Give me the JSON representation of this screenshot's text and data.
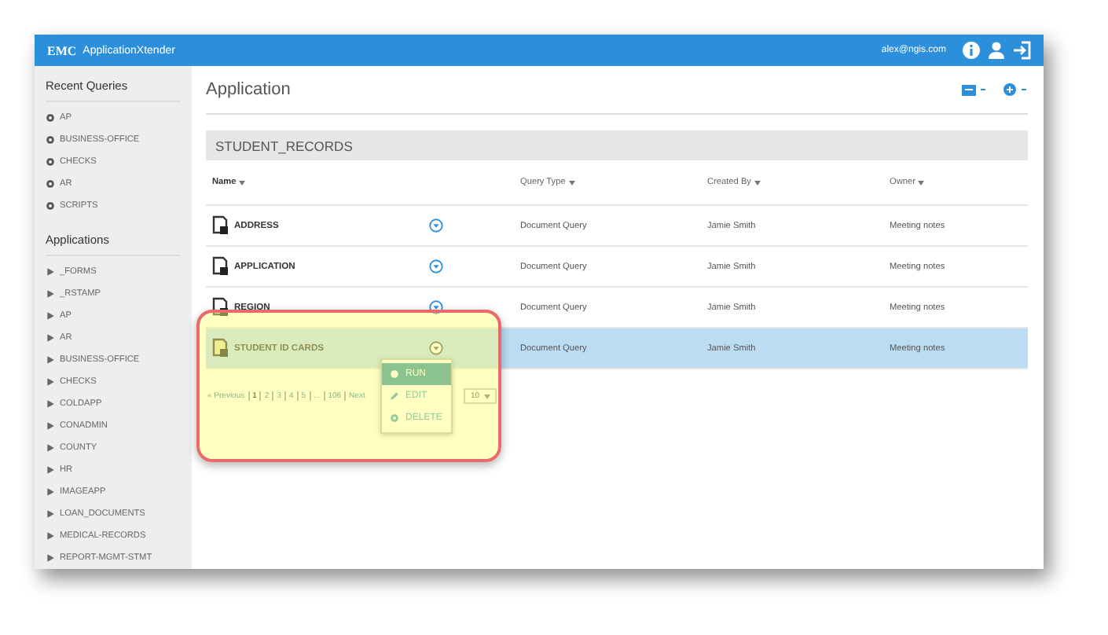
{
  "window": {
    "brand": "EMC",
    "product": "ApplicationXtender",
    "user": "alex@ngis.com"
  },
  "sidebar": {
    "sections": [
      {
        "title": "Recent Queries",
        "kind": "recent",
        "items": [
          "AP",
          "BUSINESS-OFFICE",
          "CHECKS",
          "AR",
          "SCRIPTS"
        ]
      },
      {
        "title": "Applications",
        "kind": "apps",
        "items": [
          "_FORMS",
          "_RSTAMP",
          "AP",
          "AR",
          "BUSINESS-OFFICE",
          "CHECKS",
          "COLDAPP",
          "CONADMIN",
          "COUNTY",
          "HR",
          "IMAGEAPP",
          "LOAN_DOCUMENTS",
          "MEDICAL-RECORDS",
          "REPORT-MGMT-STMT"
        ]
      }
    ]
  },
  "page": {
    "title": "Application"
  },
  "table": {
    "title": "STUDENT_RECORDS",
    "columns": [
      "Name",
      "Query Type",
      "Created By",
      "Owner"
    ],
    "rows": [
      {
        "name": "ADDRESS",
        "query_type": "Document Query",
        "created_by": "Jamie Smith",
        "owner": "Meeting notes",
        "selected": false
      },
      {
        "name": "APPLICATION",
        "query_type": "Document Query",
        "created_by": "Jamie Smith",
        "owner": "Meeting notes",
        "selected": false
      },
      {
        "name": "REGION",
        "query_type": "Document Query",
        "created_by": "Jamie Smith",
        "owner": "Meeting notes",
        "selected": false
      },
      {
        "name": "STUDENT ID CARDS",
        "query_type": "Document Query",
        "created_by": "Jamie Smith",
        "owner": "Meeting notes",
        "selected": true
      }
    ]
  },
  "pagination": {
    "previous": "« Previous",
    "pages": [
      {
        "label": "1",
        "selected": true
      },
      {
        "label": "2",
        "selected": false
      },
      {
        "label": "3",
        "selected": false
      },
      {
        "label": "4",
        "selected": false
      },
      {
        "label": "5",
        "selected": false
      },
      {
        "label": "...",
        "selected": false
      },
      {
        "label": "106",
        "selected": false
      }
    ],
    "next": "Next",
    "page_size": "10"
  },
  "context_menu": {
    "items": [
      {
        "label": "RUN",
        "selected": true
      },
      {
        "label": "EDIT",
        "selected": false
      },
      {
        "label": "DELETE",
        "selected": false
      }
    ]
  }
}
